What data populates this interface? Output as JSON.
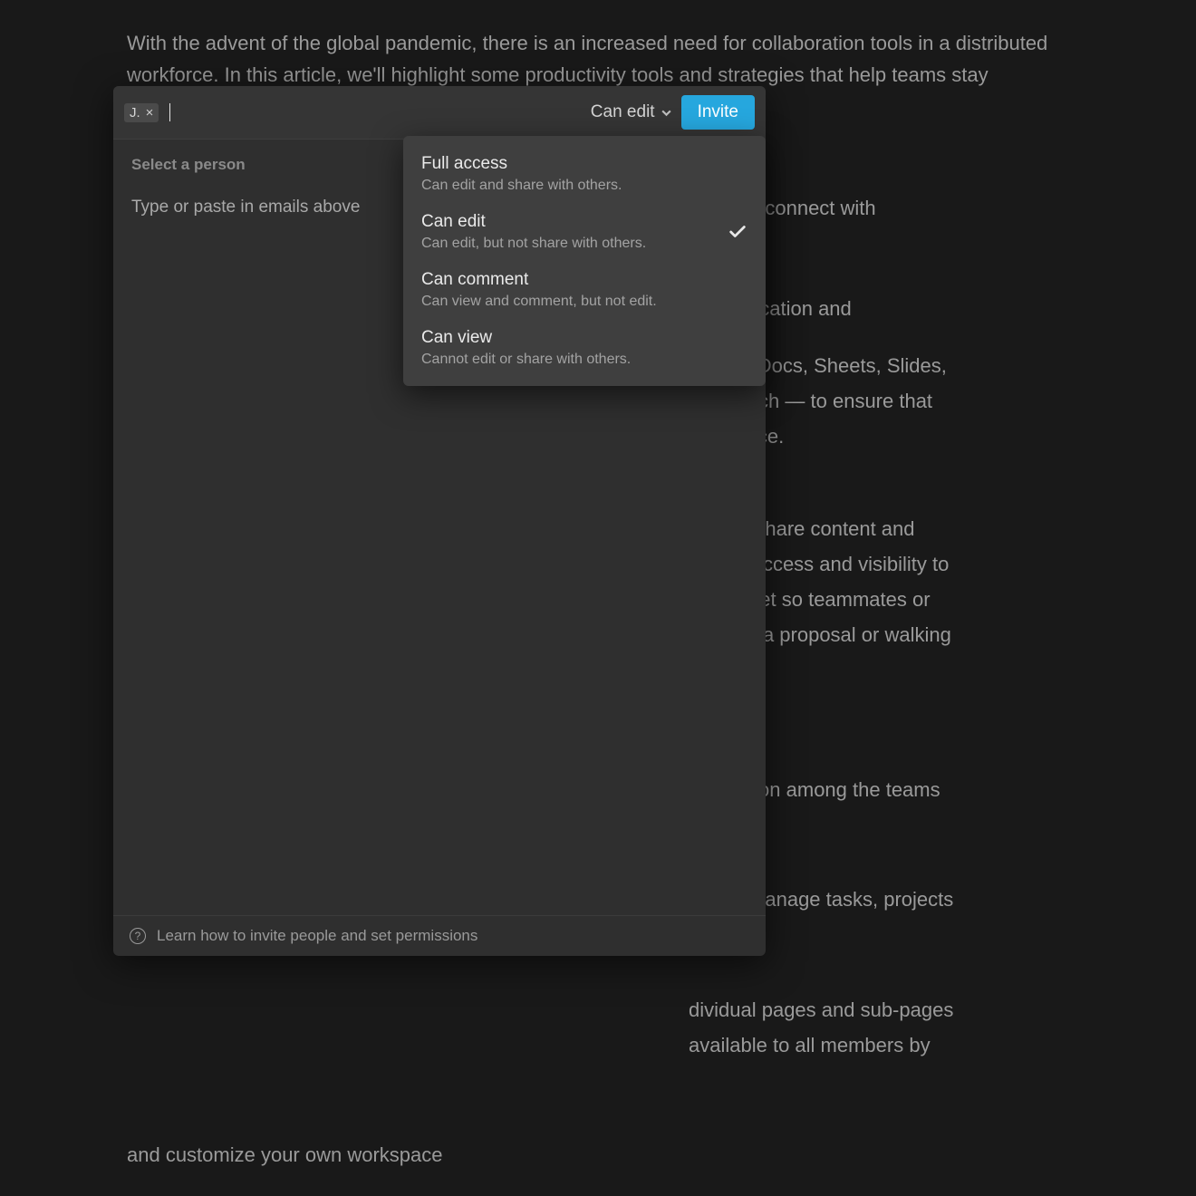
{
  "document": {
    "p1": "With the advent of the global pandemic, there is an increased need for collaboration tools in a distributed workforce. In this article, we'll highlight some productivity tools and strategies that help teams stay connected, whether they are working remotely or in the office.",
    "p2a": "users to connect with",
    "p2b": "ommunication and",
    "p2c": ", Drive, Docs, Sheets, Slides,",
    "p2d": "ud Search — to ensure that",
    "p2e": "ified place.",
    "p3a": "create, share content and",
    "p3b": "ll have access and visibility to",
    "p3c": "ogle Meet so teammates or",
    "p3d": "pitching a proposal or walking",
    "p4a": "llaboration among the teams",
    "p5a": "s, and manage tasks, projects",
    "p6a": "dividual pages and sub-pages",
    "p6b": "available to all members by",
    "p7": "and customize your own workspace"
  },
  "modal": {
    "chip": "J.",
    "permission_trigger": "Can edit",
    "invite": "Invite",
    "select_label": "Select a person",
    "hint": "Type or paste in emails above",
    "footer_link": "Learn how to invite people and set permissions"
  },
  "dropdown": {
    "items": [
      {
        "title": "Full access",
        "desc": "Can edit and share with others.",
        "selected": false
      },
      {
        "title": "Can edit",
        "desc": "Can edit, but not share with others.",
        "selected": true
      },
      {
        "title": "Can comment",
        "desc": "Can view and comment, but not edit.",
        "selected": false
      },
      {
        "title": "Can view",
        "desc": "Cannot edit or share with others.",
        "selected": false
      }
    ]
  }
}
